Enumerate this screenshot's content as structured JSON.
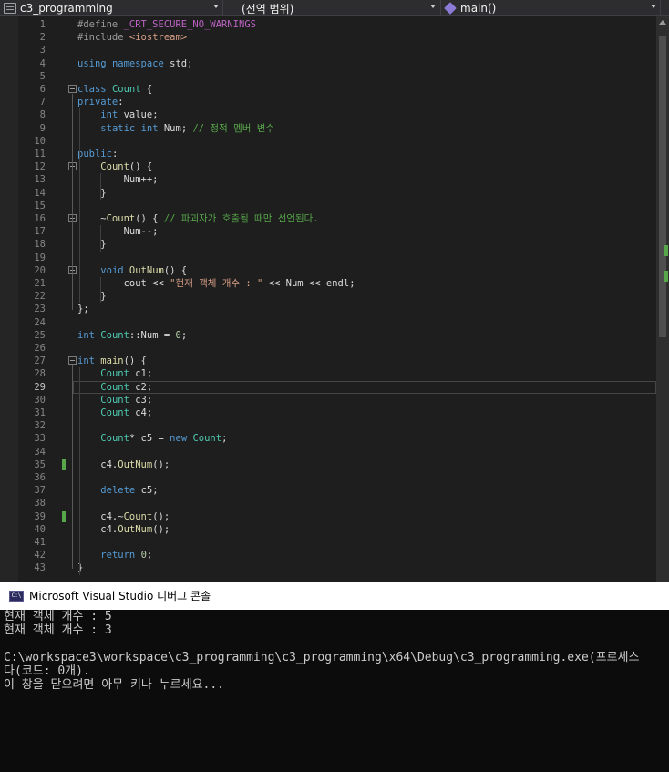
{
  "navbar": {
    "project": "c3_programming",
    "scope": "(전역 범위)",
    "member": "main()"
  },
  "editor": {
    "current_line": 29,
    "lines": [
      {
        "n": "1",
        "parts": [
          [
            "pp",
            "#define "
          ],
          [
            "mc",
            "_CRT_SECURE_NO_WARNINGS"
          ]
        ]
      },
      {
        "n": "2",
        "parts": [
          [
            "pp",
            "#include "
          ],
          [
            "st",
            "<iostream>"
          ]
        ]
      },
      {
        "n": "3",
        "parts": []
      },
      {
        "n": "4",
        "parts": [
          [
            "kw",
            "using "
          ],
          [
            "kw",
            "namespace "
          ],
          [
            "tx",
            "std;"
          ]
        ]
      },
      {
        "n": "5",
        "parts": []
      },
      {
        "n": "6",
        "parts": [
          [
            "kw",
            "class "
          ],
          [
            "ty",
            "Count "
          ],
          [
            "tx",
            "{"
          ]
        ]
      },
      {
        "n": "7",
        "parts": [
          [
            "kw",
            "private"
          ],
          [
            "tx",
            ":"
          ]
        ]
      },
      {
        "n": "8",
        "parts": [
          [
            "tx",
            "    "
          ],
          [
            "kw",
            "int "
          ],
          [
            "tx",
            "value;"
          ]
        ]
      },
      {
        "n": "9",
        "parts": [
          [
            "tx",
            "    "
          ],
          [
            "kw",
            "static "
          ],
          [
            "kw",
            "int "
          ],
          [
            "tx",
            "Num; "
          ],
          [
            "cm",
            "// 정적 멤버 변수"
          ]
        ]
      },
      {
        "n": "10",
        "parts": []
      },
      {
        "n": "11",
        "parts": [
          [
            "kw",
            "public"
          ],
          [
            "tx",
            ":"
          ]
        ]
      },
      {
        "n": "12",
        "parts": [
          [
            "tx",
            "    "
          ],
          [
            "fn",
            "Count"
          ],
          [
            "tx",
            "() {"
          ]
        ]
      },
      {
        "n": "13",
        "parts": [
          [
            "tx",
            "        Num++;"
          ]
        ]
      },
      {
        "n": "14",
        "parts": [
          [
            "tx",
            "    }"
          ]
        ]
      },
      {
        "n": "15",
        "parts": []
      },
      {
        "n": "16",
        "parts": [
          [
            "tx",
            "    ~"
          ],
          [
            "fn",
            "Count"
          ],
          [
            "tx",
            "() { "
          ],
          [
            "cm",
            "// 파괴자가 호출될 때만 선언된다."
          ]
        ]
      },
      {
        "n": "17",
        "parts": [
          [
            "tx",
            "        Num--;"
          ]
        ]
      },
      {
        "n": "18",
        "parts": [
          [
            "tx",
            "    }"
          ]
        ]
      },
      {
        "n": "19",
        "parts": []
      },
      {
        "n": "20",
        "parts": [
          [
            "tx",
            "    "
          ],
          [
            "kw",
            "void "
          ],
          [
            "fn",
            "OutNum"
          ],
          [
            "tx",
            "() {"
          ]
        ]
      },
      {
        "n": "21",
        "parts": [
          [
            "tx",
            "        cout << "
          ],
          [
            "st",
            "\"현재 객체 개수 : \""
          ],
          [
            "tx",
            " << Num << endl;"
          ]
        ]
      },
      {
        "n": "22",
        "parts": [
          [
            "tx",
            "    }"
          ]
        ]
      },
      {
        "n": "23",
        "parts": [
          [
            "tx",
            "};"
          ]
        ]
      },
      {
        "n": "24",
        "parts": []
      },
      {
        "n": "25",
        "parts": [
          [
            "kw",
            "int "
          ],
          [
            "ty",
            "Count"
          ],
          [
            "tx",
            "::Num = "
          ],
          [
            "nm",
            "0"
          ],
          [
            "tx",
            ";"
          ]
        ]
      },
      {
        "n": "26",
        "parts": []
      },
      {
        "n": "27",
        "parts": [
          [
            "kw",
            "int "
          ],
          [
            "fn",
            "main"
          ],
          [
            "tx",
            "() {"
          ]
        ]
      },
      {
        "n": "28",
        "parts": [
          [
            "tx",
            "    "
          ],
          [
            "ty",
            "Count "
          ],
          [
            "tx",
            "c1;"
          ]
        ]
      },
      {
        "n": "29",
        "parts": [
          [
            "tx",
            "    "
          ],
          [
            "ty",
            "Count "
          ],
          [
            "tx",
            "c2;"
          ]
        ]
      },
      {
        "n": "30",
        "parts": [
          [
            "tx",
            "    "
          ],
          [
            "ty",
            "Count "
          ],
          [
            "tx",
            "c3;"
          ]
        ]
      },
      {
        "n": "31",
        "parts": [
          [
            "tx",
            "    "
          ],
          [
            "ty",
            "Count "
          ],
          [
            "tx",
            "c4;"
          ]
        ]
      },
      {
        "n": "32",
        "parts": []
      },
      {
        "n": "33",
        "parts": [
          [
            "tx",
            "    "
          ],
          [
            "ty",
            "Count"
          ],
          [
            "tx",
            "* c5 = "
          ],
          [
            "kw",
            "new "
          ],
          [
            "ty",
            "Count"
          ],
          [
            "tx",
            ";"
          ]
        ]
      },
      {
        "n": "34",
        "parts": []
      },
      {
        "n": "35",
        "parts": [
          [
            "tx",
            "    c4."
          ],
          [
            "fn",
            "OutNum"
          ],
          [
            "tx",
            "();"
          ]
        ]
      },
      {
        "n": "36",
        "parts": []
      },
      {
        "n": "37",
        "parts": [
          [
            "tx",
            "    "
          ],
          [
            "kw",
            "delete "
          ],
          [
            "tx",
            "c5;"
          ]
        ]
      },
      {
        "n": "38",
        "parts": []
      },
      {
        "n": "39",
        "parts": [
          [
            "tx",
            "    c4.~"
          ],
          [
            "fn",
            "Count"
          ],
          [
            "tx",
            "();"
          ]
        ]
      },
      {
        "n": "40",
        "parts": [
          [
            "tx",
            "    c4."
          ],
          [
            "fn",
            "OutNum"
          ],
          [
            "tx",
            "();"
          ]
        ]
      },
      {
        "n": "41",
        "parts": []
      },
      {
        "n": "42",
        "parts": [
          [
            "tx",
            "    "
          ],
          [
            "kw",
            "return "
          ],
          [
            "nm",
            "0"
          ],
          [
            "tx",
            ";"
          ]
        ]
      },
      {
        "n": "43",
        "parts": [
          [
            "tx",
            "}"
          ]
        ]
      }
    ]
  },
  "console": {
    "title": "Microsoft Visual Studio 디버그 콘솔",
    "icon_label": "C:\\",
    "lines": [
      "현재 객체 개수 : 5",
      "현재 객체 개수 : 3",
      "",
      "C:\\workspace3\\workspace\\c3_programming\\c3_programming\\x64\\Debug\\c3_programming.exe(프로세스",
      "다(코드: 0개).",
      "이 창을 닫으려면 아무 키나 누르세요..."
    ]
  }
}
